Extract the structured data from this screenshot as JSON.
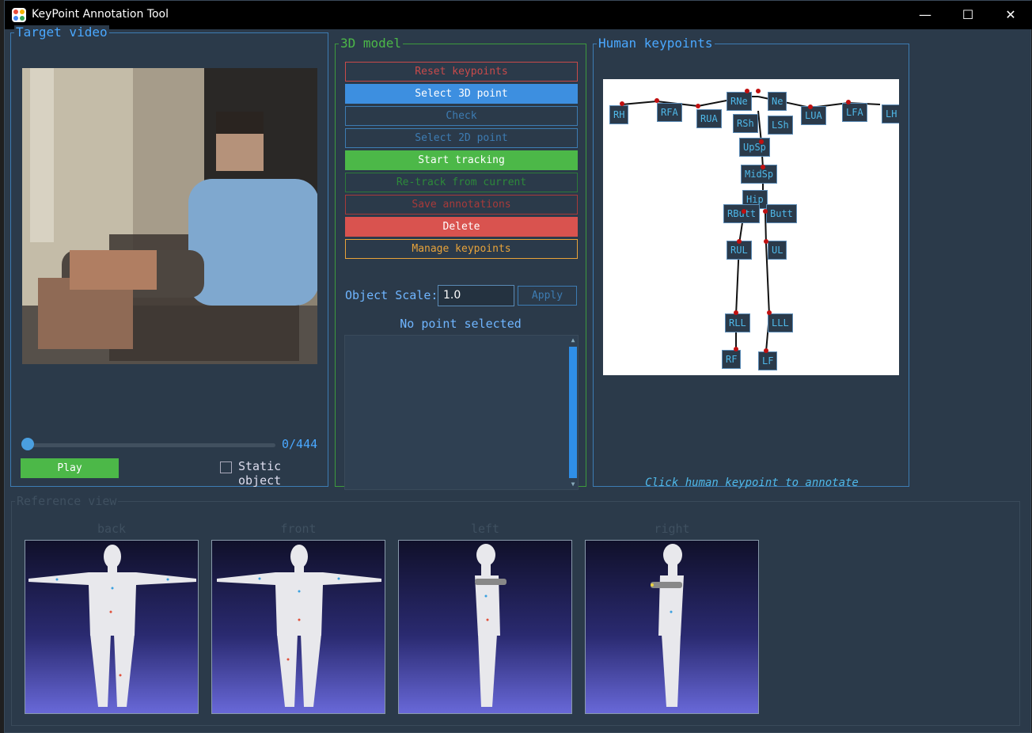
{
  "window": {
    "title": "KeyPoint Annotation Tool"
  },
  "target_video": {
    "title": "Target video",
    "frame_count": "0/444",
    "play_label": "Play",
    "static_label": "Static object",
    "progress": 0.0
  },
  "model3d": {
    "title": "3D model",
    "buttons": {
      "reset": "Reset keypoints",
      "select3d": "Select 3D point",
      "check": "Check",
      "select2d": "Select 2D point",
      "start_tracking": "Start tracking",
      "retrack": "Re-track from current",
      "save": "Save annotations",
      "delete": "Delete",
      "manage": "Manage keypoints"
    },
    "scale_label": "Object Scale:",
    "scale_value": "1.0",
    "apply_label": "Apply",
    "selection_status": "No point selected"
  },
  "human_keypoints": {
    "title": "Human keypoints",
    "hint": "Click human keypoint to annotate",
    "labels": {
      "rh": "RH",
      "rfa": "RFA",
      "rua": "RUA",
      "rne": "RNe",
      "ne": "Ne",
      "rsh": "RSh",
      "lsh": "LSh",
      "lua": "LUA",
      "lfa": "LFA",
      "lh": "LH",
      "upsp": "UpSp",
      "midsp": "MidSp",
      "hip": "Hip",
      "rbutt": "RButt",
      "butt": "Butt",
      "rul": "RUL",
      "ul": "UL",
      "rll": "RLL",
      "lll": "LLL",
      "rf": "RF",
      "lf": "LF"
    }
  },
  "reference": {
    "title": "Reference view",
    "views": [
      "back",
      "front",
      "left",
      "right"
    ]
  },
  "colors": {
    "accent_blue": "#4aa8ff",
    "green": "#4cb848",
    "red": "#d9534f",
    "orange": "#e8a33a"
  }
}
